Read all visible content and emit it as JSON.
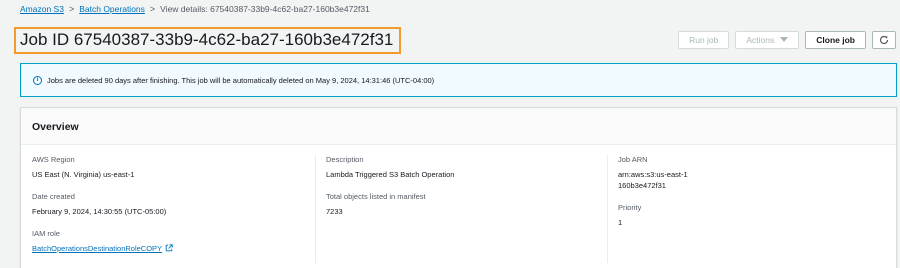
{
  "breadcrumb": {
    "items": [
      "Amazon S3",
      "Batch Operations",
      "View details: 67540387-33b9-4c62-ba27-160b3e472f31"
    ],
    "separator": ">"
  },
  "page": {
    "title": "Job ID 67540387-33b9-4c62-ba27-160b3e472f31"
  },
  "toolbar": {
    "run_job": "Run job",
    "actions": "Actions",
    "clone_job": "Clone job"
  },
  "alert": {
    "message": "Jobs are deleted 90 days after finishing. This job will be automatically deleted on May 9, 2024, 14:31:46 (UTC-04:00)"
  },
  "overview": {
    "title": "Overview",
    "aws_region_label": "AWS Region",
    "aws_region_value": "US East (N. Virginia) us-east-1",
    "date_created_label": "Date created",
    "date_created_value": "February 9, 2024, 14:30:55 (UTC-05:00)",
    "iam_role_label": "IAM role",
    "iam_role_value": "BatchOperationsDestinationRoleCOPY",
    "description_label": "Description",
    "description_value": "Lambda Triggered S3 Batch Operation",
    "total_objects_label": "Total objects listed in manifest",
    "total_objects_value": "7233",
    "job_arn_label": "Job ARN",
    "job_arn_line1": "arn:aws:s3:us-east-1",
    "job_arn_line2": "160b3e472f31",
    "priority_label": "Priority",
    "priority_value": "1"
  },
  "colors": {
    "link": "#0073bb",
    "highlight": "#f29a2e",
    "alert_border": "#00a1c9",
    "alert_bg": "#f1faff"
  }
}
